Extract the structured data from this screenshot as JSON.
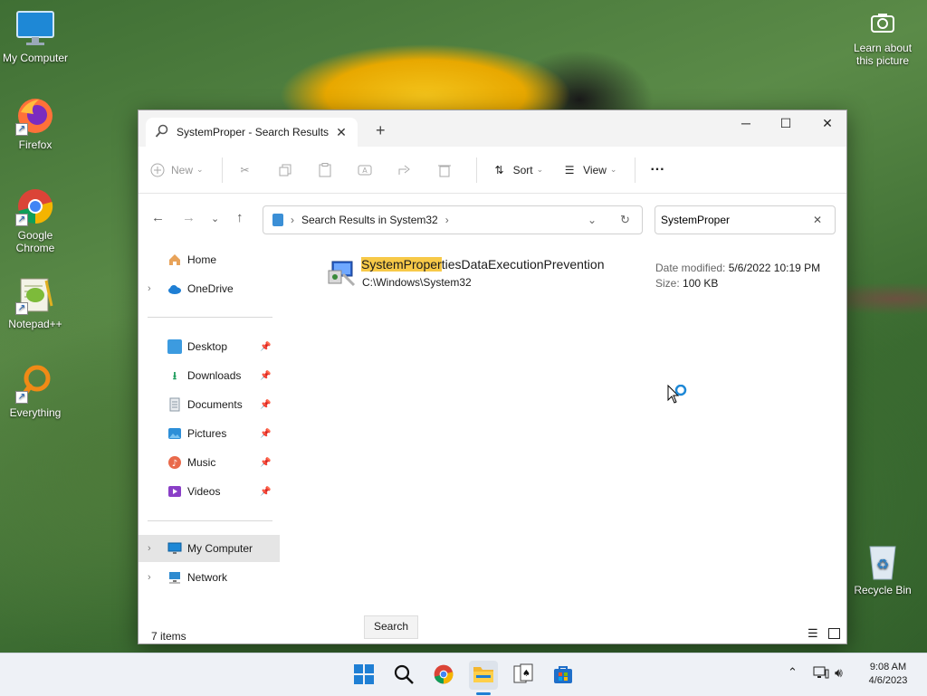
{
  "desktop": {
    "icons": [
      {
        "label": "My Computer",
        "icon": "monitor-icon"
      },
      {
        "label": "Firefox",
        "icon": "firefox-icon"
      },
      {
        "label": "Google Chrome",
        "icon": "chrome-icon"
      },
      {
        "label": "Notepad++",
        "icon": "notepadpp-icon"
      },
      {
        "label": "Everything",
        "icon": "search-magnifier-icon"
      },
      {
        "label": "Recycle Bin",
        "icon": "recycle-bin-icon"
      }
    ],
    "learn_about": "Learn about this picture"
  },
  "window": {
    "tab_title": "SystemProper - Search Results",
    "toolbar": {
      "new_label": "New",
      "sort_label": "Sort",
      "view_label": "View",
      "more_label": "···"
    },
    "address": {
      "breadcrumb": "Search Results in System32"
    },
    "search": {
      "value": "SystemProper"
    },
    "sidebar": {
      "home": "Home",
      "onedrive": "OneDrive",
      "quick": [
        {
          "label": "Desktop"
        },
        {
          "label": "Downloads"
        },
        {
          "label": "Documents"
        },
        {
          "label": "Pictures"
        },
        {
          "label": "Music"
        },
        {
          "label": "Videos"
        }
      ],
      "my_computer": "My Computer",
      "network": "Network"
    },
    "result": {
      "name_match": "SystemProper",
      "name_rest": "tiesDataExecutionPrevention",
      "path": "C:\\Windows\\System32",
      "date_label": "Date modified:",
      "date_value": "5/6/2022 10:19 PM",
      "size_label": "Size:",
      "size_value": "100 KB"
    },
    "status": {
      "items": "7 items"
    }
  },
  "tooltip": "Search",
  "taskbar": {
    "time": "9:08 AM",
    "date": "4/6/2023"
  }
}
